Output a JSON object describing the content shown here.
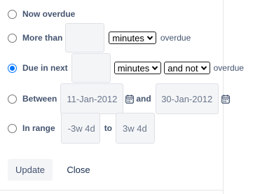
{
  "options": {
    "now_overdue": {
      "label": "Now overdue",
      "selected": false
    },
    "more_than": {
      "label": "More than",
      "value": "",
      "unit_selected": "minutes",
      "suffix": "overdue",
      "selected": false
    },
    "due_in_next": {
      "label": "Due in next",
      "value": "",
      "unit_selected": "minutes",
      "qualifier_selected": "and not",
      "suffix": "overdue",
      "selected": true
    },
    "between": {
      "label": "Between",
      "from_date": "11-Jan-2012",
      "connector": "and",
      "to_date": "30-Jan-2012",
      "selected": false
    },
    "in_range": {
      "label": "In range",
      "from_value": "-3w 4d",
      "connector": "to",
      "to_value": "3w 4d",
      "selected": false
    }
  },
  "actions": {
    "update_label": "Update",
    "close_label": "Close"
  },
  "colors": {
    "radio_selected": "#0075ff",
    "input_bg": "#f4f5f7",
    "label_text": "#44546f"
  },
  "icons": {
    "calendar": "calendar-icon",
    "dropdown": "chevron-down-icon"
  }
}
